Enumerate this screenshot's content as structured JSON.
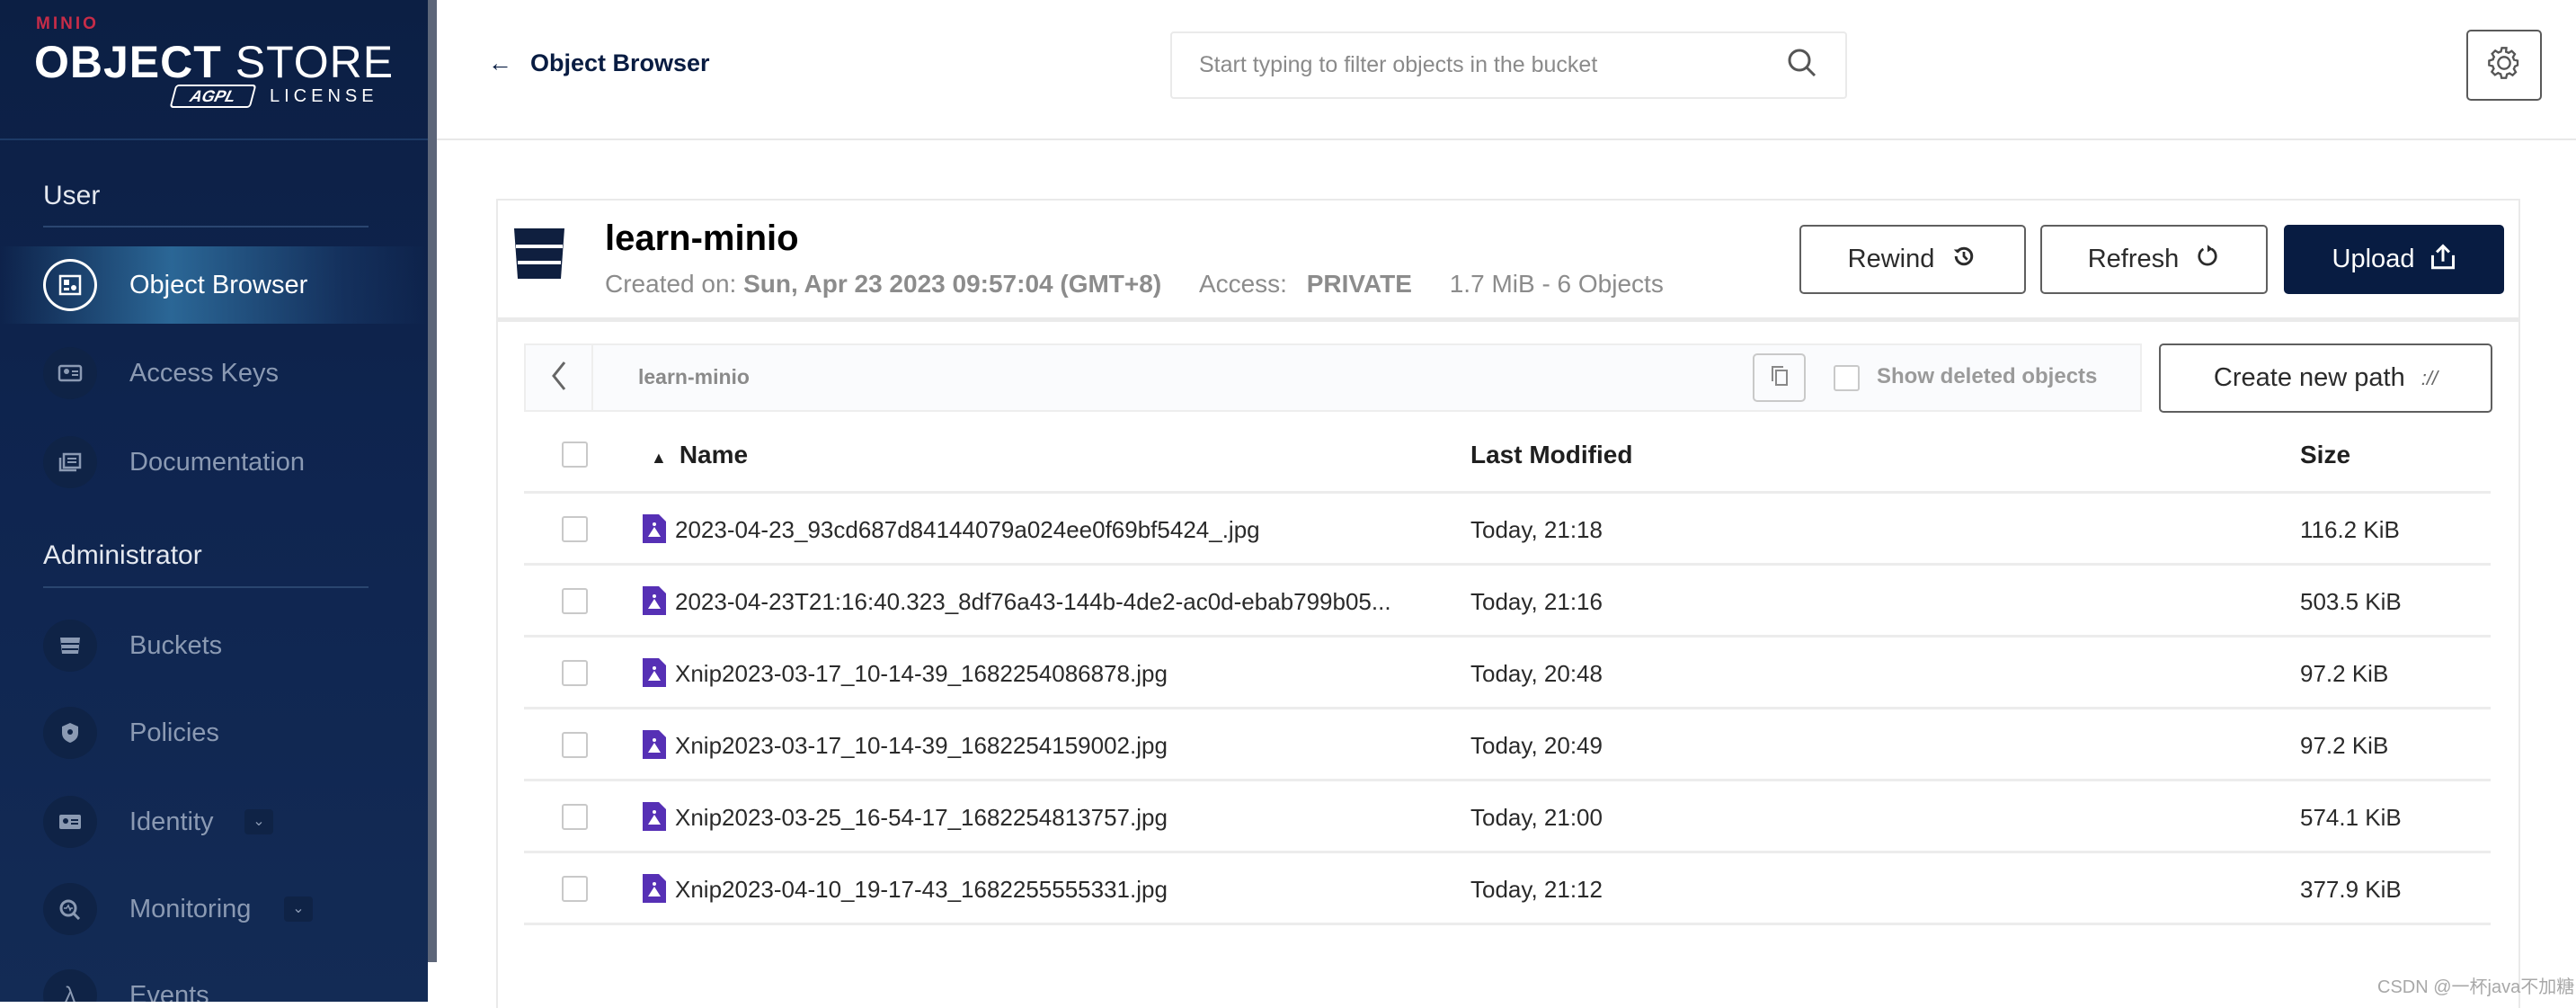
{
  "logo": {
    "brand": "MINIO",
    "product_bold": "OBJECT",
    "product": "STORE",
    "license_badge": "AGPL",
    "license": "LICENSE"
  },
  "sidebar": {
    "sections": [
      {
        "title": "User",
        "items": [
          {
            "label": "Object Browser",
            "icon": "object-browser-icon",
            "active": true
          },
          {
            "label": "Access Keys",
            "icon": "access-keys-icon"
          },
          {
            "label": "Documentation",
            "icon": "documentation-icon"
          }
        ]
      },
      {
        "title": "Administrator",
        "items": [
          {
            "label": "Buckets",
            "icon": "bucket-icon"
          },
          {
            "label": "Policies",
            "icon": "policies-icon"
          },
          {
            "label": "Identity",
            "icon": "identity-icon",
            "expandable": true
          },
          {
            "label": "Monitoring",
            "icon": "monitoring-icon",
            "expandable": true
          },
          {
            "label": "Events",
            "icon": "lambda-icon"
          }
        ]
      }
    ]
  },
  "header": {
    "back_label": "Object Browser",
    "search_placeholder": "Start typing to filter objects in the bucket"
  },
  "bucket": {
    "name": "learn-minio",
    "created_label": "Created on:",
    "created_value": "Sun, Apr 23 2023 09:57:04 (GMT+8)",
    "access_label": "Access:",
    "access_value": "PRIVATE",
    "usage": "1.7 MiB - 6 Objects",
    "buttons": {
      "rewind": "Rewind",
      "refresh": "Refresh",
      "upload": "Upload"
    }
  },
  "browser": {
    "breadcrumb": "learn-minio",
    "show_deleted_label": "Show deleted objects",
    "create_path_label": "Create new path",
    "columns": {
      "name": "Name",
      "last_modified": "Last Modified",
      "size": "Size"
    },
    "sort": "name-ascending",
    "rows": [
      {
        "name": "2023-04-23_93cd687d84144079a024ee0f69bf5424_.jpg",
        "modified": "Today, 21:18",
        "size": "116.2 KiB"
      },
      {
        "name": "2023-04-23T21:16:40.323_8df76a43-144b-4de2-ac0d-ebab799b05...",
        "modified": "Today, 21:16",
        "size": "503.5 KiB"
      },
      {
        "name": "Xnip2023-03-17_10-14-39_1682254086878.jpg",
        "modified": "Today, 20:48",
        "size": "97.2 KiB"
      },
      {
        "name": "Xnip2023-03-17_10-14-39_1682254159002.jpg",
        "modified": "Today, 20:49",
        "size": "97.2 KiB"
      },
      {
        "name": "Xnip2023-03-25_16-54-17_1682254813757.jpg",
        "modified": "Today, 21:00",
        "size": "574.1 KiB"
      },
      {
        "name": "Xnip2023-04-10_19-17-43_1682255555331.jpg",
        "modified": "Today, 21:12",
        "size": "377.9 KiB"
      }
    ]
  },
  "watermark": "CSDN @一杯java不加糖",
  "colors": {
    "sidebar": "#0f2550",
    "primary": "#081c42",
    "file_icon": "#5630b5",
    "brand_red": "#c72c48"
  }
}
